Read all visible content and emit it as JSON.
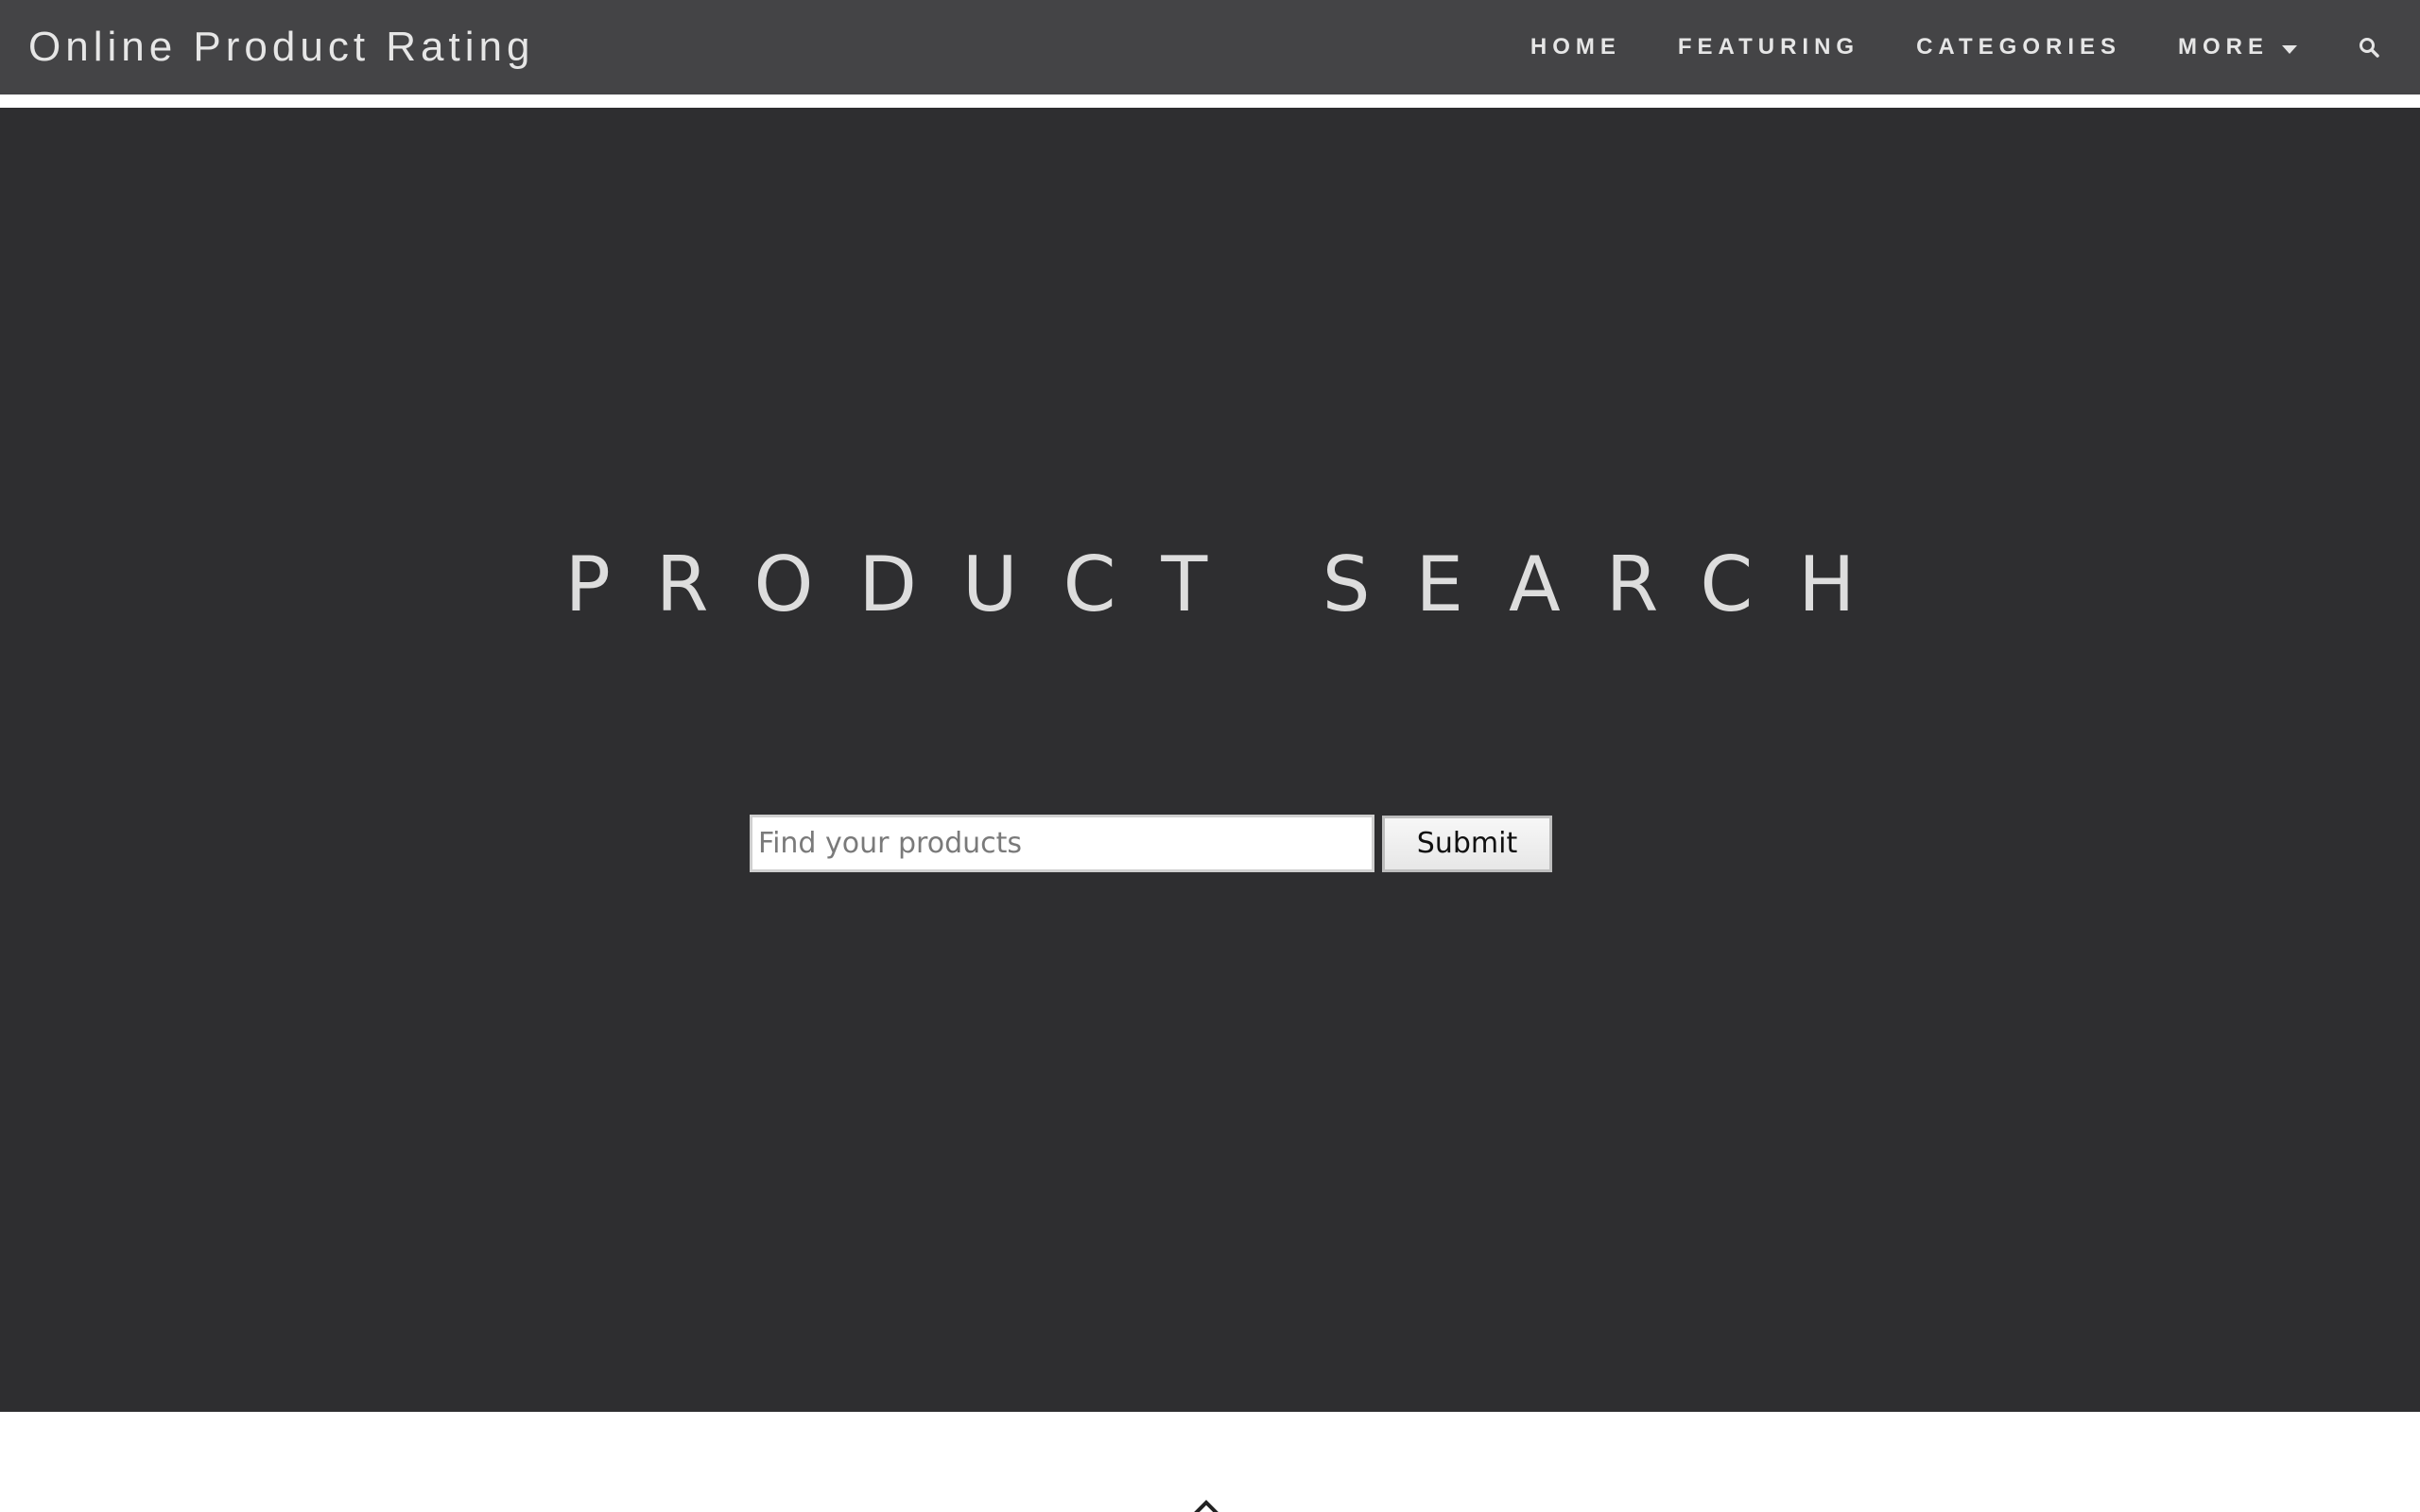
{
  "navbar": {
    "brand": "Online Product Rating",
    "links": [
      {
        "label": "HOME"
      },
      {
        "label": "FEATURING"
      },
      {
        "label": "CATEGORIES"
      },
      {
        "label": "MORE"
      }
    ],
    "search_icon": "search-icon",
    "more_icon": "caret-down-icon",
    "background": "#444446"
  },
  "hero": {
    "title": "PRODUCT SEARCH",
    "background": "#2e2e30",
    "search": {
      "placeholder": "Find your products",
      "value": "",
      "submit_label": "Submit"
    }
  },
  "footer_hint": {
    "icon": "chevron-up-icon"
  }
}
